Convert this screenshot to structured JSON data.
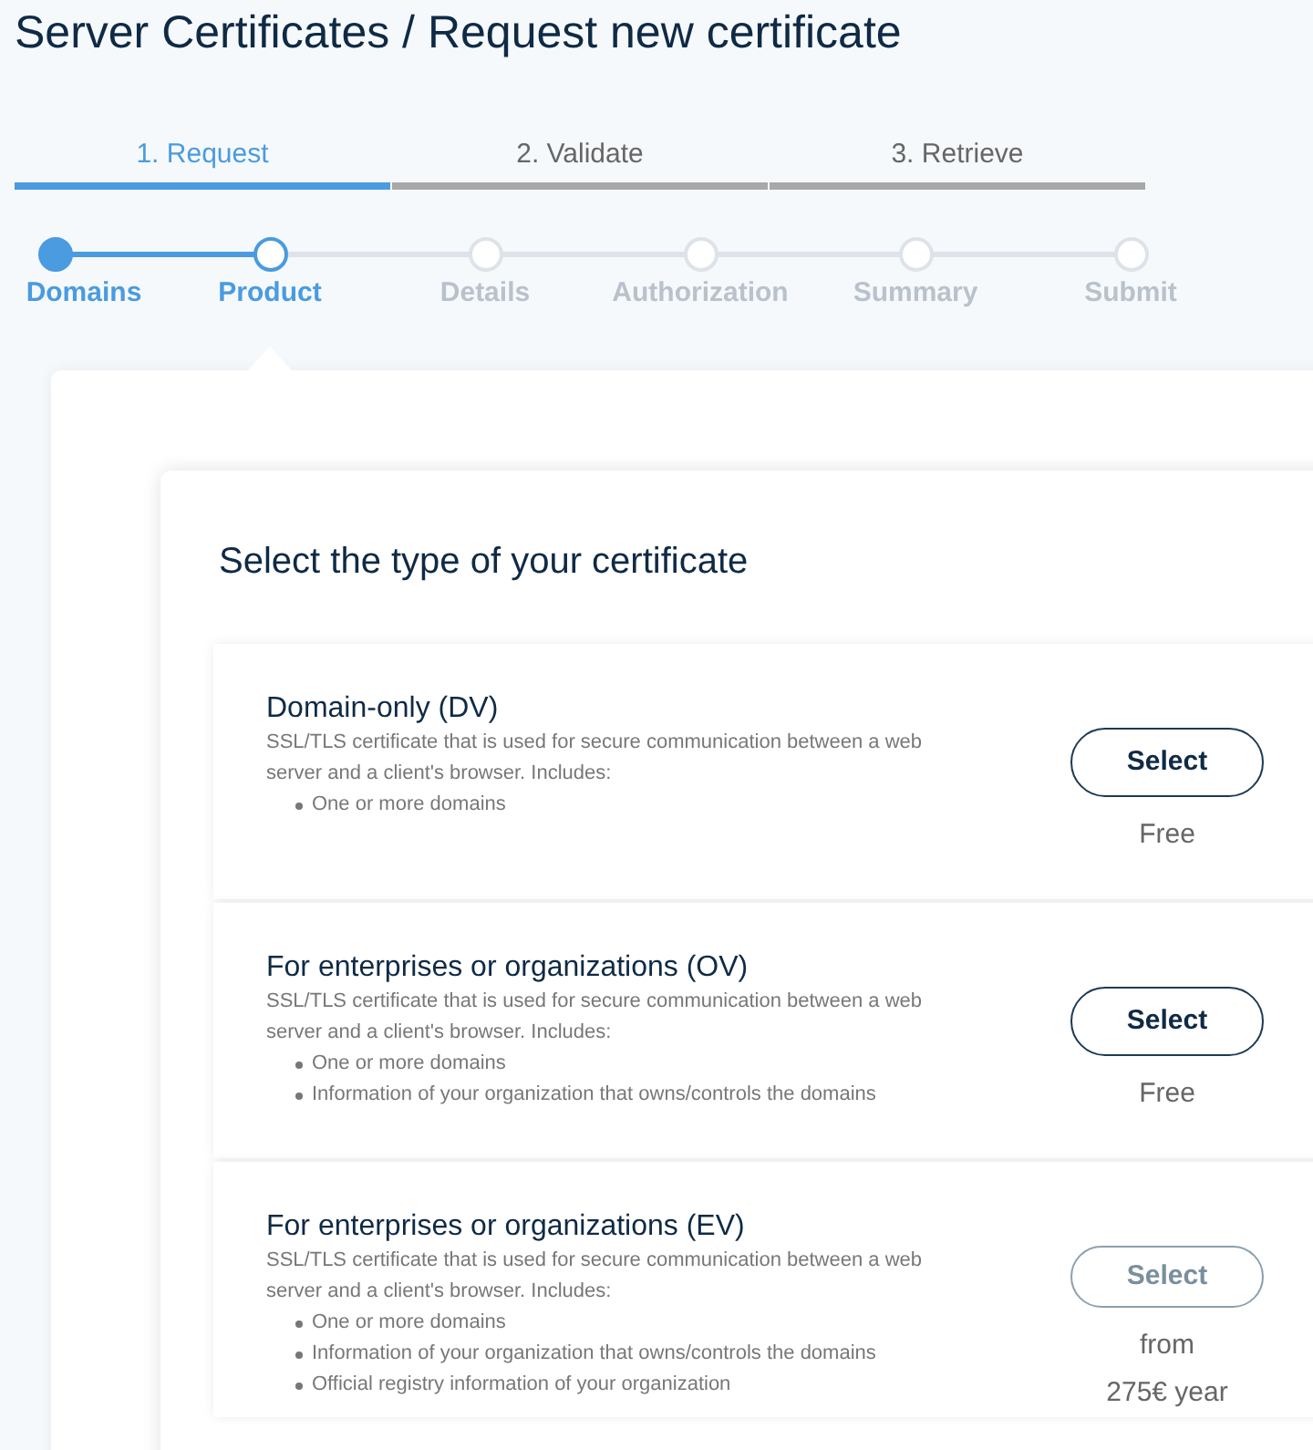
{
  "page_title": "Server Certificates / Request new certificate",
  "tabs": [
    {
      "label": "1. Request",
      "selected": true
    },
    {
      "label": "2. Validate",
      "selected": false
    },
    {
      "label": "3. Retrieve",
      "selected": false
    }
  ],
  "steps": [
    {
      "label": "Domains",
      "done": true,
      "selected": false
    },
    {
      "label": "Product",
      "done": false,
      "selected": true
    },
    {
      "label": "Details",
      "done": false,
      "selected": false
    },
    {
      "label": "Authorization",
      "done": false,
      "selected": false
    },
    {
      "label": "Summary",
      "done": false,
      "selected": false
    },
    {
      "label": "Submit",
      "done": false,
      "selected": false
    }
  ],
  "section_title": "Select the type of your certificate",
  "options": [
    {
      "title": "Domain-only (DV)",
      "description": "SSL/TLS certificate that is used for secure communication between a web server and a client's browser. Includes:",
      "features": [
        "One or more domains"
      ],
      "button": "Select",
      "disabled": false,
      "price": [
        "Free"
      ]
    },
    {
      "title": "For enterprises or organizations (OV)",
      "description": "SSL/TLS certificate that is used for secure communication between a web server and a client's browser. Includes:",
      "features": [
        "One or more domains",
        "Information of your organization that owns/controls the domains"
      ],
      "button": "Select",
      "disabled": false,
      "price": [
        "Free"
      ]
    },
    {
      "title": "For enterprises or organizations (EV)",
      "description": "SSL/TLS certificate that is used for secure communication between a web server and a client's browser. Includes:",
      "features": [
        "One or more domains",
        "Information of your organization that owns/controls the domains",
        "Official registry information of your organization"
      ],
      "button": "Select",
      "disabled": true,
      "price": [
        "from",
        "275€ year"
      ]
    }
  ]
}
